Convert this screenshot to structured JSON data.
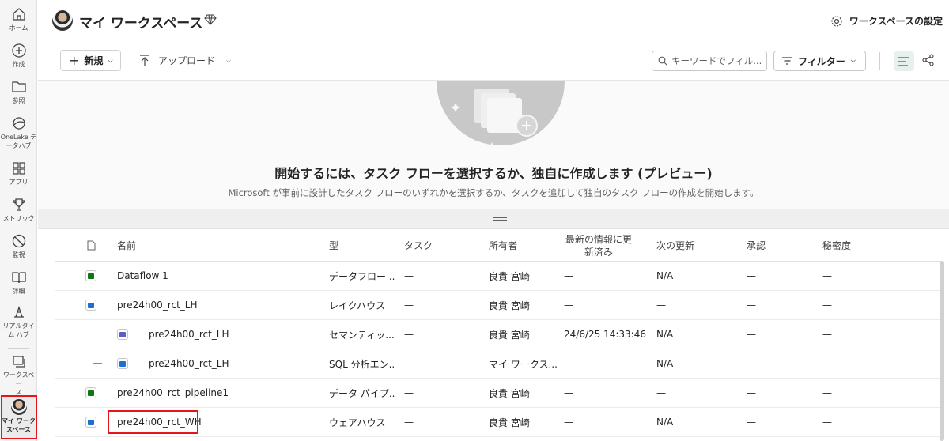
{
  "rail": [
    {
      "label": "ホーム",
      "icon": "home-icon"
    },
    {
      "label": "作成",
      "icon": "create-icon"
    },
    {
      "label": "参照",
      "icon": "browse-icon"
    },
    {
      "label": "OneLake デ\nータハブ",
      "icon": "onelake-icon"
    },
    {
      "label": "アプリ",
      "icon": "apps-icon"
    },
    {
      "label": "メトリック",
      "icon": "trophy-icon"
    },
    {
      "label": "監視",
      "icon": "monitor-icon"
    },
    {
      "label": "詳細",
      "icon": "book-icon"
    },
    {
      "label": "リアルタイ\nム ハブ",
      "icon": "realtime-icon"
    },
    {
      "label": "ワークスペー\nス",
      "icon": "workspaces-icon"
    },
    {
      "label": "マイ ワーク\nスペース",
      "icon": "avatar"
    }
  ],
  "header": {
    "title": "マイ ワークスペース",
    "settings_label": "ワークスペースの設定"
  },
  "toolbar": {
    "new_label": "新規",
    "upload_label": "アップロード",
    "search_placeholder": "キーワードでフィル...",
    "filter_label": "フィルター"
  },
  "hero": {
    "title": "開始するには、タスク フローを選択するか、独自に作成します (プレビュー)",
    "subtitle": "Microsoft が事前に設計したタスク フローのいずれかを選択するか、タスクを追加して独自のタスク フローの作成を開始します。"
  },
  "table": {
    "headers": {
      "name": "名前",
      "type": "型",
      "task": "タスク",
      "owner": "所有者",
      "refreshed": "最新の情報に更新済み",
      "next": "次の更新",
      "endorsement": "承認",
      "sensitivity": "秘密度"
    },
    "rows": [
      {
        "name": "Dataflow 1",
        "type": "データフロー ...",
        "task": "—",
        "owner": "良貴 宮崎",
        "refreshed": "—",
        "next": "N/A",
        "endorsement": "—",
        "sensitivity": "—",
        "icon": "dataflow-icon",
        "icon_color": "#0e7a0d",
        "indent": false
      },
      {
        "name": "pre24h00_rct_LH",
        "type": "レイクハウス",
        "task": "—",
        "owner": "良貴 宮崎",
        "refreshed": "—",
        "next": "—",
        "endorsement": "—",
        "sensitivity": "—",
        "icon": "lakehouse-icon",
        "icon_color": "#1f6fd1",
        "indent": false
      },
      {
        "name": "pre24h00_rct_LH",
        "type": "セマンティッ...",
        "task": "—",
        "owner": "良貴 宮崎",
        "refreshed": "24/6/25 14:33:46",
        "next": "N/A",
        "endorsement": "—",
        "sensitivity": "—",
        "icon": "semantic-model-icon",
        "icon_color": "#5b5fc7",
        "indent": true
      },
      {
        "name": "pre24h00_rct_LH",
        "type": "SQL 分析エン...",
        "task": "—",
        "owner": "マイ ワークス...",
        "refreshed": "—",
        "next": "N/A",
        "endorsement": "—",
        "sensitivity": "—",
        "icon": "sql-endpoint-icon",
        "icon_color": "#1f6fd1",
        "indent": true
      },
      {
        "name": "pre24h00_rct_pipeline1",
        "type": "データ パイプ...",
        "task": "—",
        "owner": "良貴 宮崎",
        "refreshed": "—",
        "next": "—",
        "endorsement": "—",
        "sensitivity": "—",
        "icon": "pipeline-icon",
        "icon_color": "#0e7a0d",
        "indent": false
      },
      {
        "name": "pre24h00_rct_WH",
        "type": "ウェアハウス",
        "task": "—",
        "owner": "良貴 宮崎",
        "refreshed": "—",
        "next": "N/A",
        "endorsement": "—",
        "sensitivity": "—",
        "icon": "warehouse-icon",
        "icon_color": "#1f6fd1",
        "indent": false
      }
    ]
  },
  "colors": {
    "highlight": "#e4161b",
    "accent": "#117865"
  }
}
